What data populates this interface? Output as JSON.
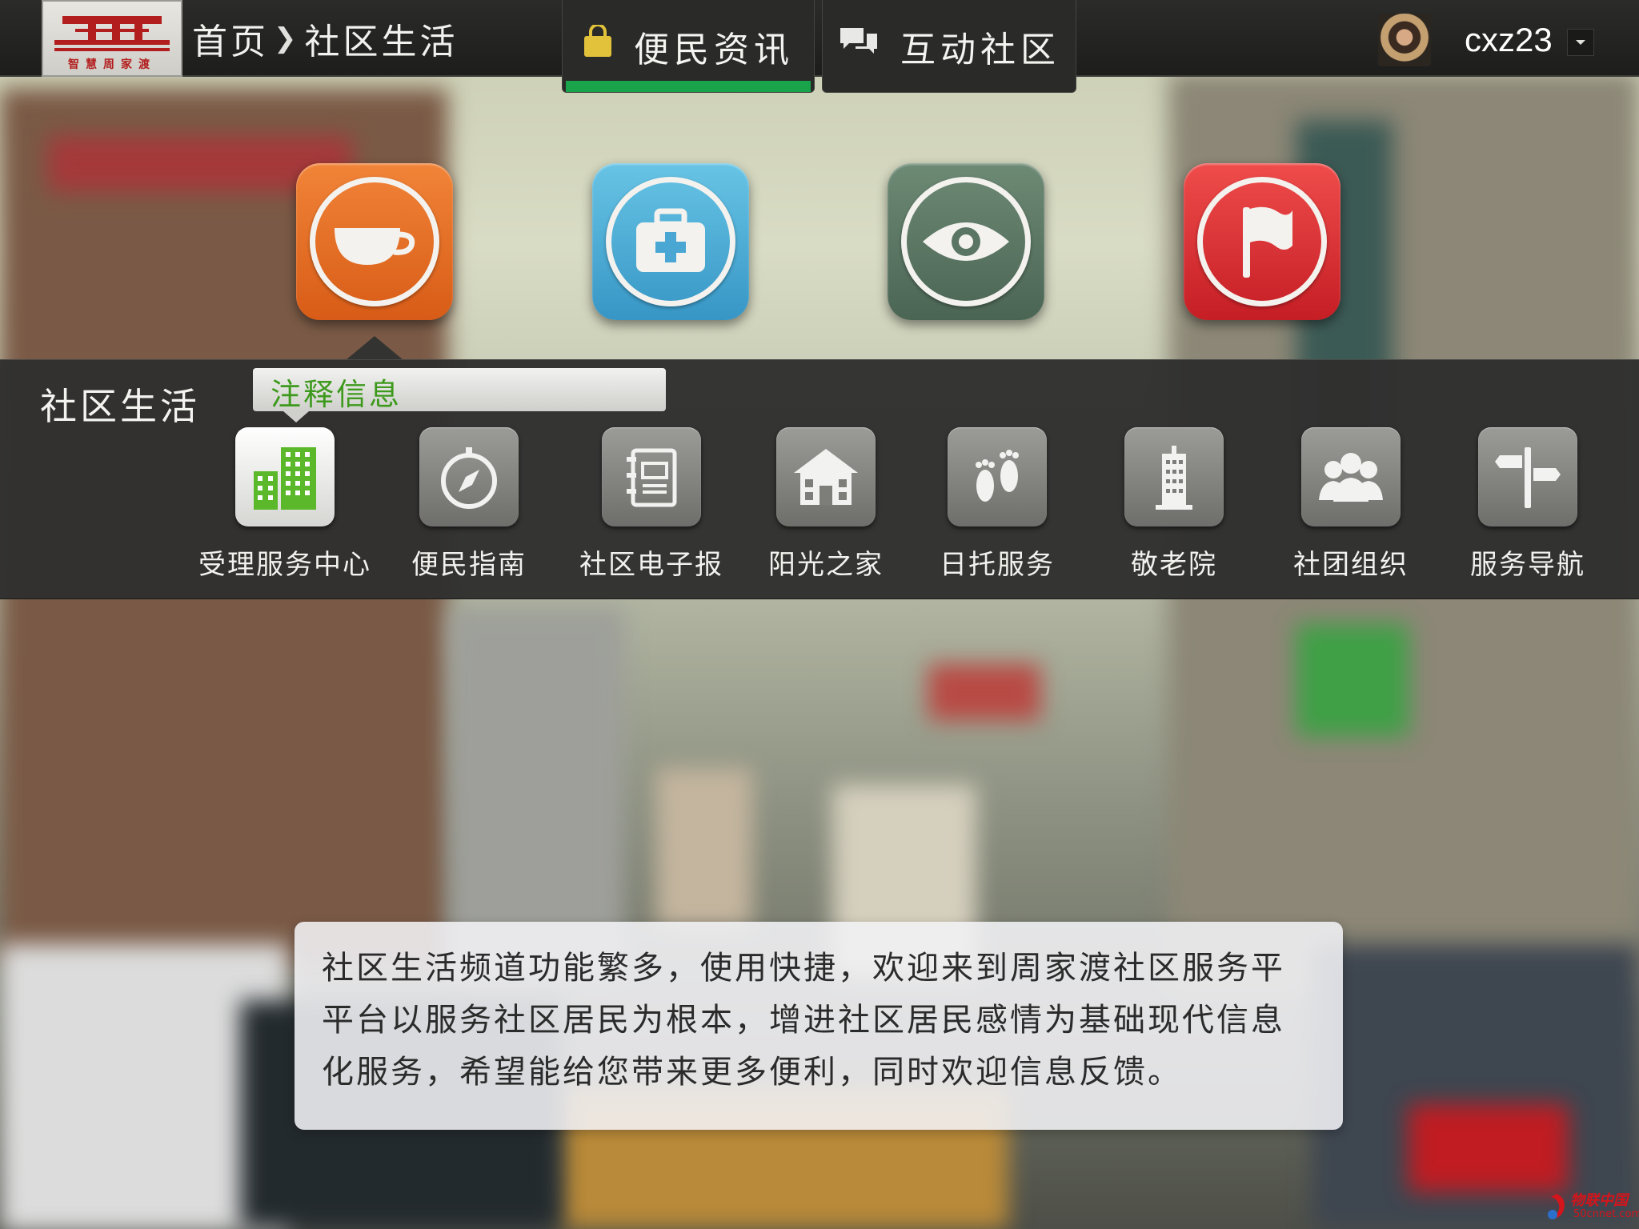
{
  "header": {
    "logo_caption": "智慧周家渡",
    "breadcrumb": {
      "home": "首页",
      "separator": "❯",
      "current": "社区生活"
    },
    "tabs": [
      {
        "label": "便民资讯",
        "icon": "shopping-bag-icon",
        "active": true
      },
      {
        "label": "互动社区",
        "icon": "chat-bubbles-icon",
        "active": false
      }
    ],
    "user": {
      "name": "cxz23"
    }
  },
  "categories": [
    {
      "icon": "coffee-cup-icon",
      "color": "#e8702a",
      "selected": true
    },
    {
      "icon": "medical-kit-icon",
      "color": "#4cb0dc",
      "selected": false
    },
    {
      "icon": "eye-icon",
      "color": "#5c7866",
      "selected": false
    },
    {
      "icon": "flag-icon",
      "color": "#dd3337",
      "selected": false
    }
  ],
  "panel": {
    "title": "社区生活",
    "tooltip": "注释信息",
    "services": [
      {
        "label": "受理服务中心",
        "icon": "buildings-icon",
        "active": true
      },
      {
        "label": "便民指南",
        "icon": "compass-icon",
        "active": false
      },
      {
        "label": "社区电子报",
        "icon": "notebook-icon",
        "active": false
      },
      {
        "label": "阳光之家",
        "icon": "house-icon",
        "active": false
      },
      {
        "label": "日托服务",
        "icon": "footprints-icon",
        "active": false
      },
      {
        "label": "敬老院",
        "icon": "tower-building-icon",
        "active": false
      },
      {
        "label": "社团组织",
        "icon": "group-people-icon",
        "active": false
      },
      {
        "label": "服务导航",
        "icon": "signpost-icon",
        "active": false
      }
    ]
  },
  "description": {
    "lines": [
      "社区生活频道功能繁多，使用快捷，欢迎来到周家渡社区服务平",
      "平台以服务社区居民为根本，增进社区居民感情为基础现代信息",
      "化服务，希望能给您带来更多便利，同时欢迎信息反馈。"
    ]
  },
  "watermark": {
    "line1": "物联中国",
    "line2": "50cnnet.com"
  },
  "colors": {
    "accent_green": "#19a34a",
    "tooltip_text": "#3d9a1d",
    "active_tile_icon": "#5ab82a"
  }
}
